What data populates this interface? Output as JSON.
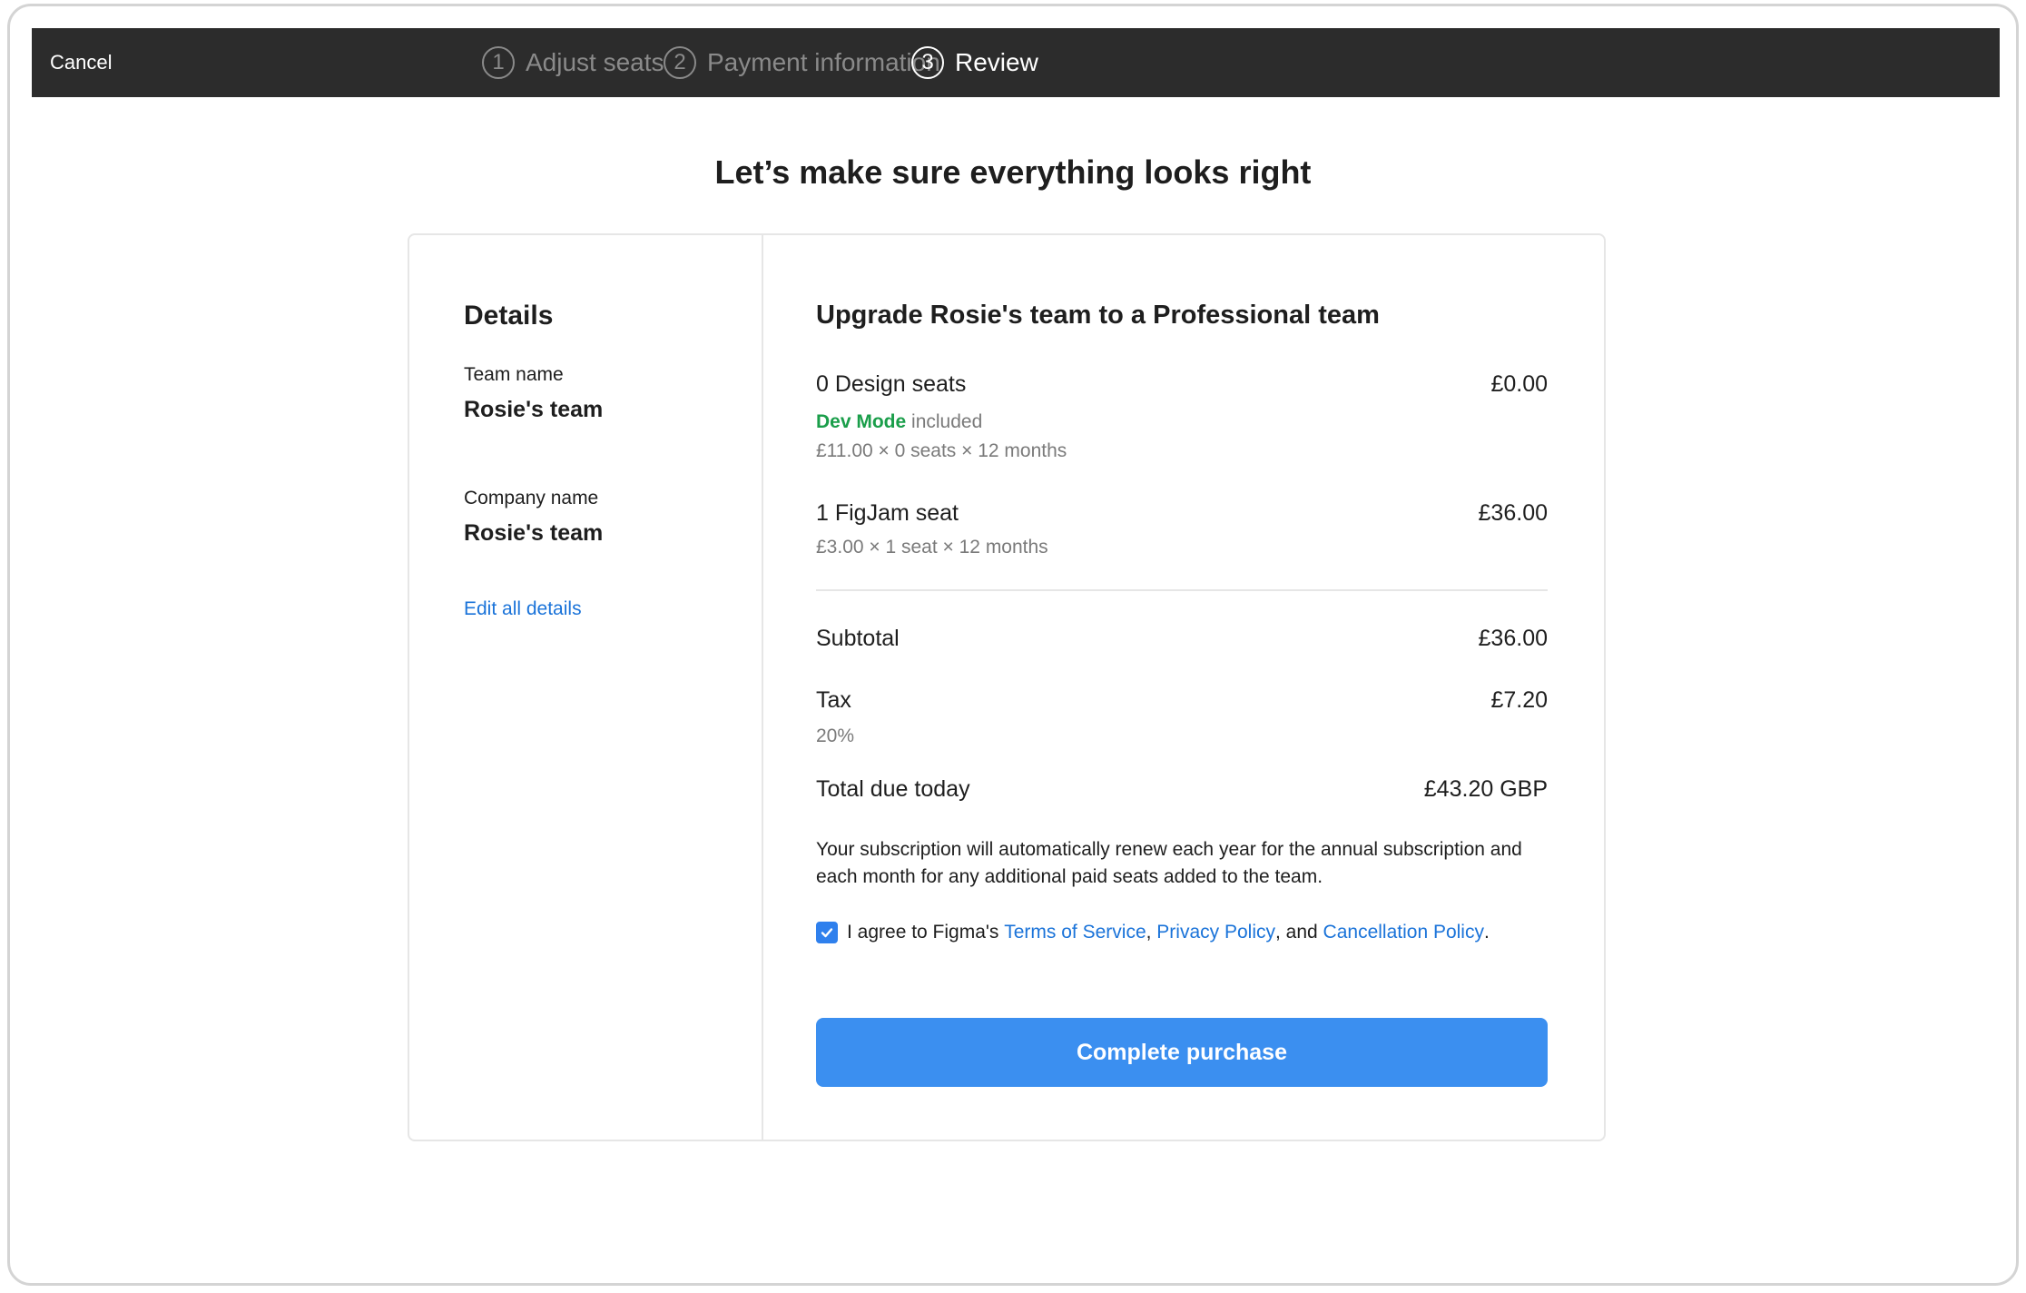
{
  "topbar": {
    "cancel_label": "Cancel",
    "steps": [
      {
        "number": "1",
        "label": "Adjust seats",
        "active": false
      },
      {
        "number": "2",
        "label": "Payment information",
        "active": false
      },
      {
        "number": "3",
        "label": "Review",
        "active": true
      }
    ]
  },
  "page_title": "Let’s make sure everything looks right",
  "details": {
    "title": "Details",
    "team_name_label": "Team name",
    "team_name_value": "Rosie's team",
    "company_name_label": "Company name",
    "company_name_value": "Rosie's team",
    "edit_link": "Edit all details"
  },
  "summary": {
    "title": "Upgrade Rosie's team to a Professional team",
    "design_seats": {
      "label": "0 Design seats",
      "price": "£0.00",
      "devmode_highlight": "Dev Mode",
      "devmode_rest": " included",
      "calc": "£11.00 × 0 seats × 12 months"
    },
    "figjam_seats": {
      "label": "1 FigJam seat",
      "price": "£36.00",
      "calc": "£3.00 × 1 seat × 12 months"
    },
    "subtotal_label": "Subtotal",
    "subtotal_value": "£36.00",
    "tax_label": "Tax",
    "tax_value": "£7.20",
    "tax_rate": "20%",
    "total_label": "Total due today",
    "total_value": "£43.20 GBP",
    "renew_note": "Your subscription will automatically renew each year for the annual subscription and each month for any additional paid seats added to the team.",
    "agree": {
      "checked": true,
      "prefix": "I agree to Figma's ",
      "terms": "Terms of Service",
      "sep1": ", ",
      "privacy": "Privacy Policy",
      "sep2": ", and ",
      "cancellation": "Cancellation Policy",
      "suffix": "."
    },
    "button_label": "Complete purchase"
  },
  "colors": {
    "topbar": "#2c2c2c",
    "accent": "#3b8ff0",
    "link": "#1a73d9",
    "devmode": "#1a9e4a"
  }
}
